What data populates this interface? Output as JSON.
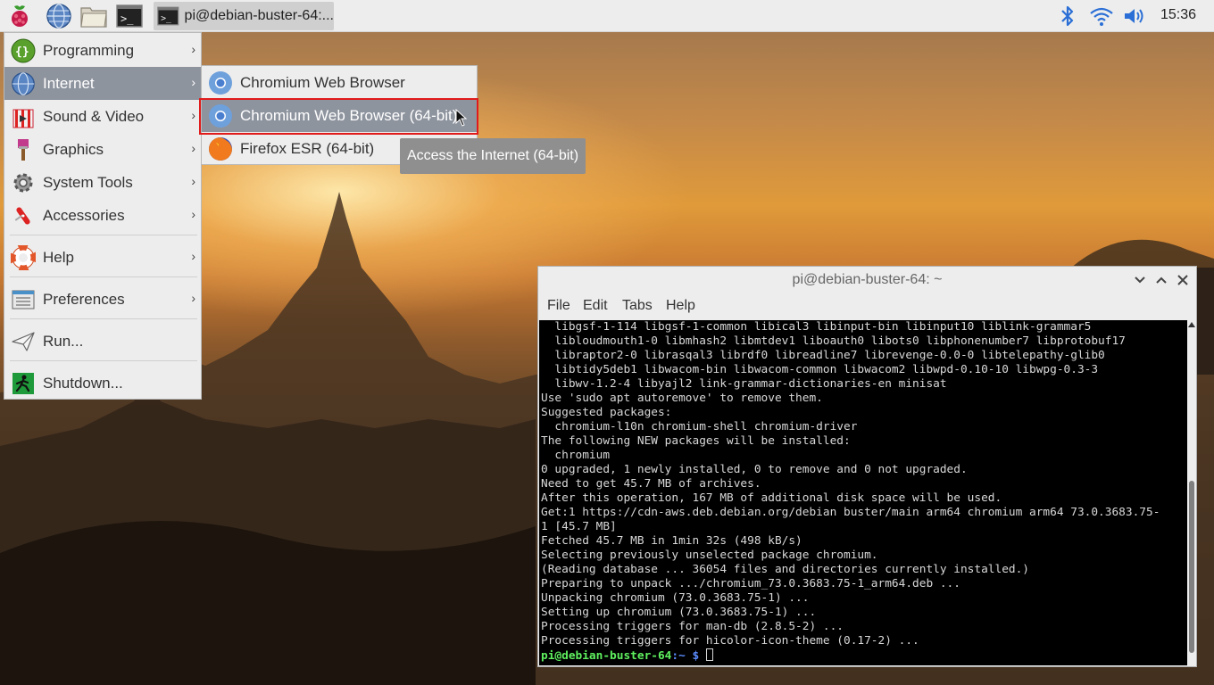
{
  "taskbar": {
    "task_label": "pi@debian-buster-64:...",
    "clock": "15:36",
    "icons": [
      "raspberry-menu-icon",
      "web-browser-icon",
      "file-manager-icon",
      "terminal-icon",
      "bluetooth-icon",
      "wifi-icon",
      "volume-icon"
    ]
  },
  "main_menu": {
    "items": [
      {
        "label": "Programming",
        "icon": "programming-icon",
        "submenu": true
      },
      {
        "label": "Internet",
        "icon": "internet-globe-icon",
        "submenu": true,
        "active": true
      },
      {
        "label": "Sound & Video",
        "icon": "sound-video-icon",
        "submenu": true
      },
      {
        "label": "Graphics",
        "icon": "graphics-icon",
        "submenu": true
      },
      {
        "label": "System Tools",
        "icon": "system-tools-icon",
        "submenu": true
      },
      {
        "label": "Accessories",
        "icon": "accessories-icon",
        "submenu": true
      },
      {
        "label": "Help",
        "icon": "help-lifebuoy-icon",
        "submenu": true
      },
      {
        "label": "Preferences",
        "icon": "preferences-icon",
        "submenu": true
      },
      {
        "label": "Run...",
        "icon": "run-icon",
        "submenu": false
      },
      {
        "label": "Shutdown...",
        "icon": "shutdown-icon",
        "submenu": false
      }
    ],
    "arrow": "›"
  },
  "sub_menu": {
    "items": [
      {
        "label": "Chromium Web Browser",
        "icon": "chromium-icon"
      },
      {
        "label": "Chromium Web Browser (64-bit)",
        "icon": "chromium-icon",
        "active": true
      },
      {
        "label": "Firefox ESR (64-bit)",
        "icon": "firefox-icon"
      }
    ]
  },
  "tooltip": "Access the Internet (64-bit)",
  "terminal": {
    "title": "pi@debian-buster-64: ~",
    "menus": [
      "File",
      "Edit",
      "Tabs",
      "Help"
    ],
    "lines": [
      "  libgsf-1-114 libgsf-1-common libical3 libinput-bin libinput10 liblink-grammar5",
      "  libloudmouth1-0 libmhash2 libmtdev1 liboauth0 libots0 libphonenumber7 libprotobuf17",
      "  libraptor2-0 librasqal3 librdf0 libreadline7 librevenge-0.0-0 libtelepathy-glib0",
      "  libtidy5deb1 libwacom-bin libwacom-common libwacom2 libwpd-0.10-10 libwpg-0.3-3",
      "  libwv-1.2-4 libyajl2 link-grammar-dictionaries-en minisat",
      "Use 'sudo apt autoremove' to remove them.",
      "Suggested packages:",
      "  chromium-l10n chromium-shell chromium-driver",
      "The following NEW packages will be installed:",
      "  chromium",
      "0 upgraded, 1 newly installed, 0 to remove and 0 not upgraded.",
      "Need to get 45.7 MB of archives.",
      "After this operation, 167 MB of additional disk space will be used.",
      "Get:1 https://cdn-aws.deb.debian.org/debian buster/main arm64 chromium arm64 73.0.3683.75-",
      "1 [45.7 MB]",
      "Fetched 45.7 MB in 1min 32s (498 kB/s)",
      "Selecting previously unselected package chromium.",
      "(Reading database ... 36054 files and directories currently installed.)",
      "Preparing to unpack .../chromium_73.0.3683.75-1_arm64.deb ...",
      "Unpacking chromium (73.0.3683.75-1) ...",
      "Setting up chromium (73.0.3683.75-1) ...",
      "Processing triggers for man-db (2.8.5-2) ...",
      "Processing triggers for hicolor-icon-theme (0.17-2) ..."
    ],
    "prompt_user": "pi@debian-buster-64",
    "prompt_path": ":~ $ "
  }
}
